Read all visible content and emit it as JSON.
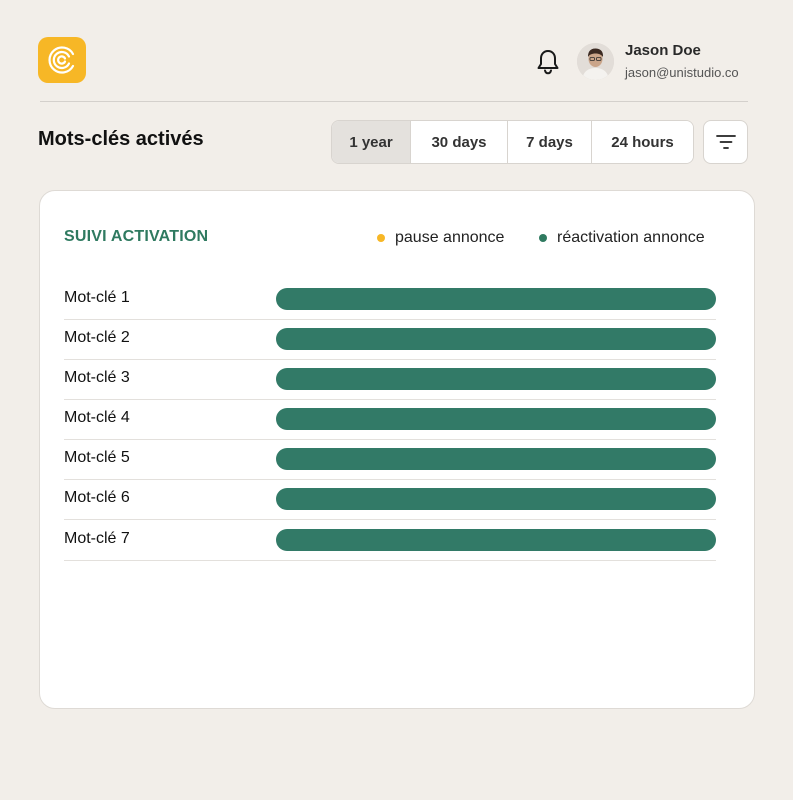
{
  "header": {
    "user_name": "Jason Doe",
    "user_email": "jason@unistudio.co"
  },
  "page": {
    "title": "Mots-clés activés"
  },
  "filters": {
    "ranges": [
      "1 year",
      "30 days",
      "7 days",
      "24 hours"
    ],
    "selected": "1 year"
  },
  "card": {
    "title": "SUIVI ACTIVATION",
    "legend": [
      {
        "label": "pause annonce",
        "color": "#f7b726"
      },
      {
        "label": "réactivation annonce",
        "color": "#2f7a60"
      }
    ],
    "rows": [
      {
        "label": "Mot-clé 1",
        "active_fraction": 1.0
      },
      {
        "label": "Mot-clé 2",
        "active_fraction": 1.0
      },
      {
        "label": "Mot-clé 3",
        "active_fraction": 1.0
      },
      {
        "label": "Mot-clé 4",
        "active_fraction": 1.0
      },
      {
        "label": "Mot-clé 5",
        "active_fraction": 1.0
      },
      {
        "label": "Mot-clé 6",
        "active_fraction": 1.0
      },
      {
        "label": "Mot-clé 7",
        "active_fraction": 1.0
      }
    ]
  },
  "colors": {
    "accent_green": "#2f7a60",
    "bar_green": "#327a67",
    "accent_yellow": "#f7b726",
    "background": "#f2eee9"
  },
  "icons": {
    "logo": "concentric-c-logo-icon",
    "notifications": "bell-icon",
    "filter": "filter-lines-icon"
  }
}
